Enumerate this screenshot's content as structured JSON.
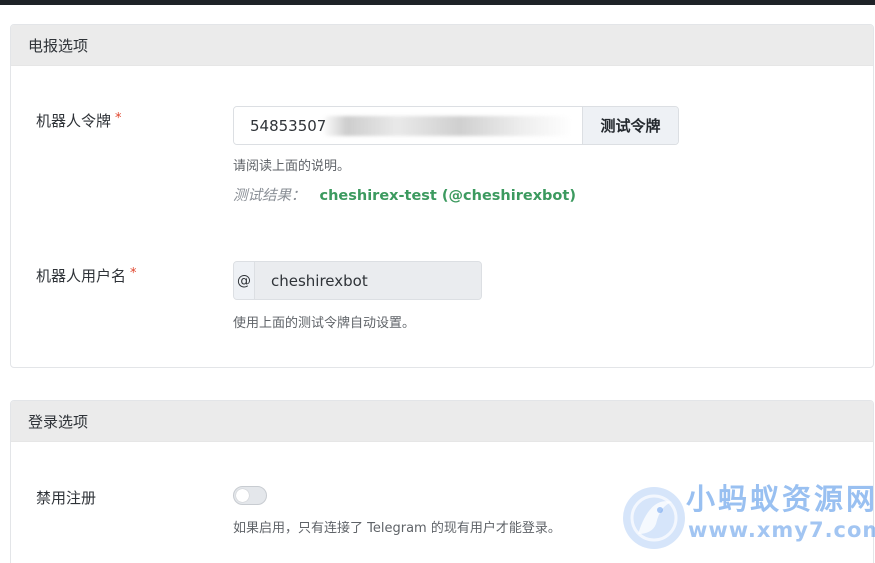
{
  "telegram_section": {
    "title": "电报选项",
    "bot_token": {
      "label": "机器人令牌",
      "required_mark": "*",
      "value": "54853507",
      "button_label": "测试令牌",
      "hint": "请阅读上面的说明。",
      "result_label": "测试结果：",
      "result_value": "cheshirex-test (@cheshirexbot)"
    },
    "bot_username": {
      "label": "机器人用户名",
      "required_mark": "*",
      "prefix": "@",
      "value": "cheshirexbot",
      "hint": "使用上面的测试令牌自动设置。"
    }
  },
  "login_section": {
    "title": "登录选项",
    "disable_registration": {
      "label": "禁用注册",
      "enabled": false,
      "hint": "如果启用，只有连接了 Telegram 的现有用户才能登录。"
    }
  },
  "watermark": {
    "name": "小蚂蚁资源网",
    "url": "www.xmy7.com"
  },
  "colors": {
    "success": "#3c9a5f",
    "required": "#e0442c",
    "header_bg": "#ebebeb"
  }
}
